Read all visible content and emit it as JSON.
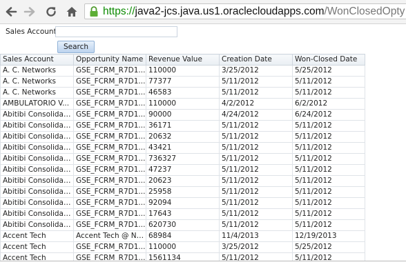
{
  "browser": {
    "url_scheme": "https://",
    "url_host": "java2-jcs.java.us1.oraclecloudapps.com",
    "url_path": "/WonClosedOpty"
  },
  "search": {
    "label": "Sales Account",
    "value": "",
    "button_label": "Search"
  },
  "table": {
    "columns": [
      "Sales Account",
      "Opportunity Name",
      "Revenue Value",
      "Creation Date",
      "Won-Closed Date"
    ],
    "rows": [
      [
        "A. C. Networks",
        "GSE_FCRM_R7D1...",
        "110000",
        "3/25/2012",
        "5/25/2012"
      ],
      [
        "A. C. Networks",
        "GSE_FCRM_R7D1...",
        "77377",
        "5/11/2012",
        "5/11/2012"
      ],
      [
        "A. C. Networks",
        "GSE_FCRM_R7D1...",
        "46583",
        "5/11/2012",
        "5/11/2012"
      ],
      [
        "AMBULATORIO V...",
        "GSE_FCRM_R7D1...",
        "110000",
        "4/2/2012",
        "6/2/2012"
      ],
      [
        "Abitibi Consolidate...",
        "GSE_FCRM_R7D1...",
        "90000",
        "4/24/2012",
        "6/24/2012"
      ],
      [
        "Abitibi Consolidate...",
        "GSE_FCRM_R7D1...",
        "36171",
        "5/11/2012",
        "5/11/2012"
      ],
      [
        "Abitibi Consolidate...",
        "GSE_FCRM_R7D1...",
        "20632",
        "5/11/2012",
        "5/11/2012"
      ],
      [
        "Abitibi Consolidate...",
        "GSE_FCRM_R7D1...",
        "43421",
        "5/11/2012",
        "5/11/2012"
      ],
      [
        "Abitibi Consolidate...",
        "GSE_FCRM_R7D1...",
        "736327",
        "5/11/2012",
        "5/11/2012"
      ],
      [
        "Abitibi Consolidate...",
        "GSE_FCRM_R7D1...",
        "47237",
        "5/11/2012",
        "5/11/2012"
      ],
      [
        "Abitibi Consolidate...",
        "GSE_FCRM_R7D1...",
        "20623",
        "5/11/2012",
        "5/11/2012"
      ],
      [
        "Abitibi Consolidate...",
        "GSE_FCRM_R7D1...",
        "25958",
        "5/11/2012",
        "5/11/2012"
      ],
      [
        "Abitibi Consolidate...",
        "GSE_FCRM_R7D1...",
        "92094",
        "5/11/2012",
        "5/11/2012"
      ],
      [
        "Abitibi Consolidate...",
        "GSE_FCRM_R7D1...",
        "17643",
        "5/11/2012",
        "5/11/2012"
      ],
      [
        "Abitibi Consolidate...",
        "GSE_FCRM_R7D1...",
        "620730",
        "5/11/2012",
        "5/11/2012"
      ],
      [
        "Accent Tech",
        "Accent Tech @ Ne...",
        "68984",
        "11/4/2013",
        "12/19/2013"
      ],
      [
        "Accent Tech",
        "GSE_FCRM_R7D1...",
        "110000",
        "3/25/2012",
        "5/25/2012"
      ],
      [
        "Accent Tech",
        "GSE_FCRM_R7D1...",
        "1561134",
        "5/11/2012",
        "5/11/2012"
      ]
    ]
  }
}
